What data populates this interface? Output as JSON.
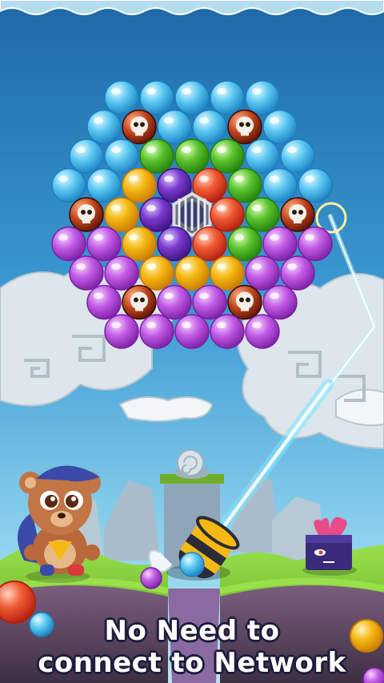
{
  "caption": {
    "line1": "No Need to",
    "line2": "connect to Network"
  },
  "colors": {
    "blue": "#5cc8f2",
    "red": "#e8432a",
    "green": "#5bc52e",
    "yellow": "#f5b914",
    "purple": "#b04fd6",
    "violet": "#6a2fbf",
    "sky_top": "#1f6fae",
    "sky_bottom": "#8fd3ee",
    "grass": "#7cc833",
    "aim_line": "#7fe3ff"
  },
  "board": {
    "rows": [
      [
        "blue",
        "blue",
        "blue",
        "blue",
        "blue"
      ],
      [
        "blue",
        "skull",
        "blue",
        "blue",
        "skull",
        "blue"
      ],
      [
        "blue",
        "blue",
        "green",
        "green",
        "green",
        "blue",
        "blue"
      ],
      [
        "blue",
        "blue",
        "yellow",
        "violet",
        "red",
        "green",
        "blue",
        "blue"
      ],
      [
        "skull",
        "yellow",
        "violet",
        "cage",
        "red",
        "green",
        "skull"
      ],
      [
        "purple",
        "purple",
        "yellow",
        "violet",
        "red",
        "green",
        "purple",
        "purple"
      ],
      [
        "purple",
        "purple",
        "yellow",
        "yellow",
        "yellow",
        "purple",
        "purple"
      ],
      [
        "purple",
        "skull",
        "purple",
        "purple",
        "skull",
        "purple"
      ],
      [
        "purple",
        "purple",
        "purple",
        "purple",
        "purple"
      ]
    ]
  },
  "shooter": {
    "loaded_bubble": "blue",
    "next_bubble": "purple"
  },
  "corner_bubbles": {
    "left": "red",
    "right": "yellow"
  },
  "icons": [
    "bear-character-icon",
    "monster-box-icon",
    "cannon-icon",
    "skull-bubble-icon",
    "cage-icon",
    "snail-statue-icon"
  ]
}
